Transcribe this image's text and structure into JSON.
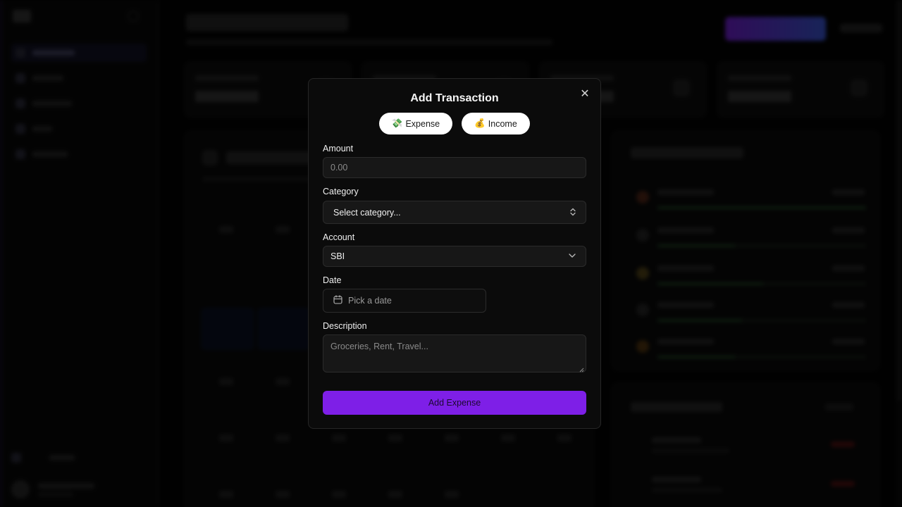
{
  "dialog": {
    "title": "Add Transaction",
    "type_toggle": {
      "expense": {
        "emoji": "💸",
        "label": "Expense"
      },
      "income": {
        "emoji": "💰",
        "label": "Income"
      }
    },
    "amount": {
      "label": "Amount",
      "placeholder": "0.00"
    },
    "category": {
      "label": "Category",
      "value": "Select category..."
    },
    "account": {
      "label": "Account",
      "value": "SBI"
    },
    "date": {
      "label": "Date",
      "placeholder": "Pick a date"
    },
    "description": {
      "label": "Description",
      "placeholder": "Groceries, Rent, Travel..."
    },
    "submit_label": "Add Expense",
    "close_glyph": "✕"
  },
  "colors": {
    "accent": "#7e1fe7",
    "dialog_bg": "#0b0b0b",
    "field_bg": "#171717",
    "overlay": "rgba(0,0,0,0.62)"
  }
}
